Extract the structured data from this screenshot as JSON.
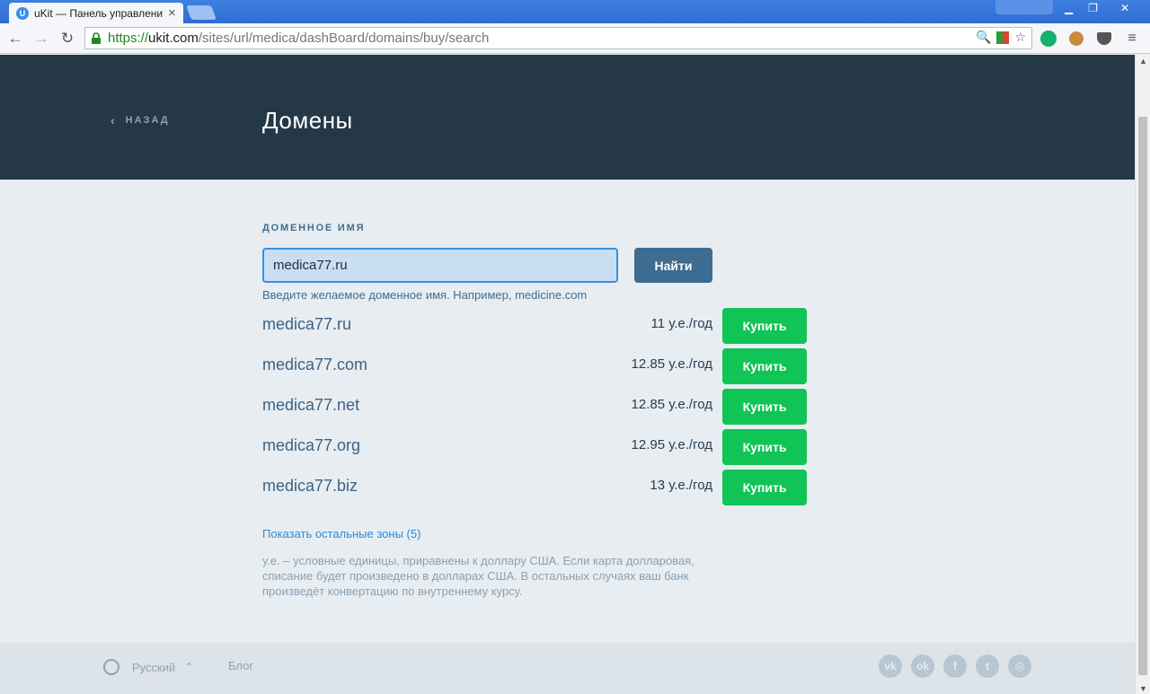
{
  "browser": {
    "tab_title": "uKit — Панель управлени",
    "tab_favicon": "U",
    "url_scheme": "https://",
    "url_host": "ukit.com",
    "url_path": "/sites/url/medica/dashBoard/domains/buy/search"
  },
  "header": {
    "back_label": "НАЗАД",
    "title": "Домены"
  },
  "search": {
    "label": "ДОМЕННОЕ ИМЯ",
    "value": "medica77.ru",
    "button": "Найти",
    "hint": "Введите желаемое доменное имя. Например, medicine.com"
  },
  "results": [
    {
      "domain": "medica77.ru",
      "price": "11 у.е./год",
      "buy": "Купить"
    },
    {
      "domain": "medica77.com",
      "price": "12.85 у.е./год",
      "buy": "Купить"
    },
    {
      "domain": "medica77.net",
      "price": "12.85 у.е./год",
      "buy": "Купить"
    },
    {
      "domain": "medica77.org",
      "price": "12.95 у.е./год",
      "buy": "Купить"
    },
    {
      "domain": "medica77.biz",
      "price": "13 у.е./год",
      "buy": "Купить"
    }
  ],
  "more_zones": "Показать остальные зоны (5)",
  "note": "у.е. – условные единицы, приравнены к доллару США. Если карта долларовая, списание будет произведено в долларах США. В остальных случаях ваш банк произведёт конвертацию по внутреннему курсу.",
  "footer": {
    "language": "Русский",
    "blog": "Блог",
    "socials": [
      "vk-icon",
      "odnoklassniki-icon",
      "facebook-icon",
      "twitter-icon",
      "instagram-icon"
    ]
  },
  "colors": {
    "header_bg": "#243846",
    "buy_green": "#10c456",
    "find_blue": "#3e6c90",
    "link_blue": "#2f8ad6"
  }
}
